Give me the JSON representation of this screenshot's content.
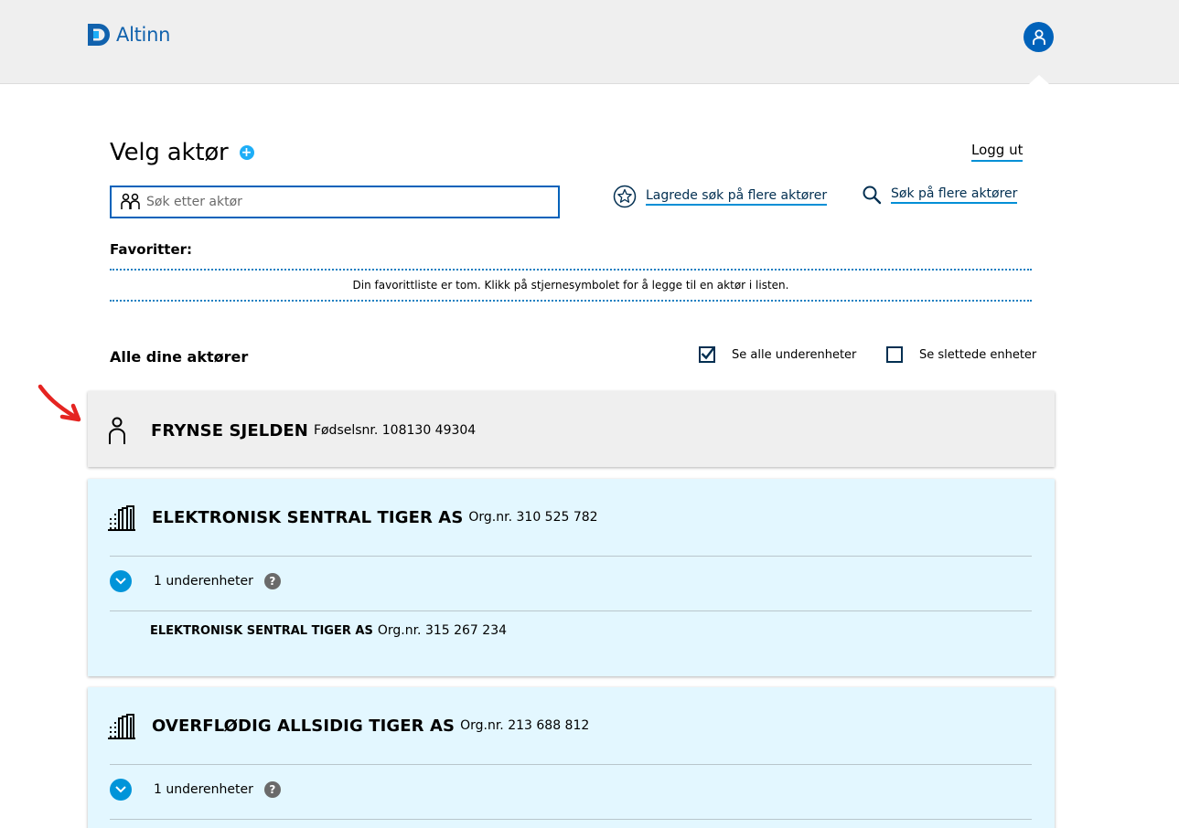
{
  "header": {
    "logo_text": "Altinn",
    "brand_color": "#0062ba"
  },
  "page": {
    "title": "Velg aktør",
    "logout": "Logg ut"
  },
  "search": {
    "placeholder": "Søk etter aktør",
    "saved_searches_link": "Lagrede søk på flere aktører",
    "search_multiple_link": "Søk på flere aktører"
  },
  "favorites": {
    "heading": "Favoritter:",
    "empty_message": "Din favorittliste er tom. Klikk på stjernesymbolet for å legge til en aktør i listen."
  },
  "actors": {
    "heading": "Alle dine aktører",
    "show_subunits": {
      "label": "Se alle underenheter",
      "checked": true
    },
    "show_deleted": {
      "label": "Se slettede enheter",
      "checked": false
    },
    "list": [
      {
        "type": "person",
        "icon": "person-icon",
        "name": "FRYNSE SJELDEN",
        "number": "Fødselsnr. 108130 49304"
      },
      {
        "type": "organization",
        "icon": "building-icon",
        "name": "ELEKTRONISK SENTRAL TIGER AS",
        "number": "Org.nr. 310 525 782",
        "subunits_label": "1 underenheter",
        "subunits": [
          {
            "name": "ELEKTRONISK SENTRAL TIGER AS",
            "number": "Org.nr. 315 267 234"
          }
        ]
      },
      {
        "type": "organization",
        "icon": "building-icon",
        "name": "OVERFLØDIG ALLSIDIG TIGER AS",
        "number": "Org.nr. 213 688 812",
        "subunits_label": "1 underenheter"
      }
    ]
  }
}
